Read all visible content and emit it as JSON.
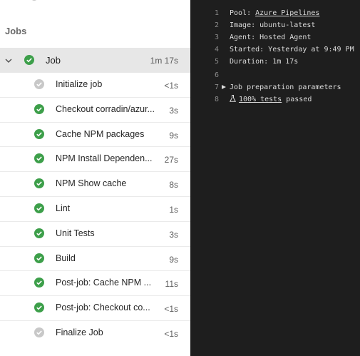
{
  "left": {
    "heading": "Jobs",
    "job": {
      "name": "Job",
      "duration": "1m 17s",
      "status": "success"
    },
    "steps": [
      {
        "name": "Initialize job",
        "duration": "<1s",
        "status": "skipped"
      },
      {
        "name": "Checkout corradin/azur...",
        "duration": "3s",
        "status": "success"
      },
      {
        "name": "Cache NPM packages",
        "duration": "9s",
        "status": "success"
      },
      {
        "name": "NPM Install Dependen...",
        "duration": "27s",
        "status": "success"
      },
      {
        "name": "NPM Show cache",
        "duration": "8s",
        "status": "success"
      },
      {
        "name": "Lint",
        "duration": "1s",
        "status": "success"
      },
      {
        "name": "Unit Tests",
        "duration": "3s",
        "status": "success"
      },
      {
        "name": "Build",
        "duration": "9s",
        "status": "success"
      },
      {
        "name": "Post-job: Cache NPM ...",
        "duration": "11s",
        "status": "success"
      },
      {
        "name": "Post-job: Checkout co...",
        "duration": "<1s",
        "status": "success"
      },
      {
        "name": "Finalize Job",
        "duration": "<1s",
        "status": "skipped"
      }
    ]
  },
  "log": {
    "line1": {
      "num": "1",
      "label": "Pool: ",
      "link": "Azure Pipelines"
    },
    "line2": {
      "num": "2",
      "text": "Image: ubuntu-latest"
    },
    "line3": {
      "num": "3",
      "text": "Agent: Hosted Agent"
    },
    "line4": {
      "num": "4",
      "text": "Started: Yesterday at 9:49 PM"
    },
    "line5": {
      "num": "5",
      "text": "Duration: 1m 17s"
    },
    "line6": {
      "num": "6",
      "text": ""
    },
    "line7": {
      "num": "7",
      "text": "Job preparation parameters"
    },
    "line8": {
      "num": "8",
      "link": "100% tests",
      "suffix": " passed"
    }
  },
  "colors": {
    "success": "#3d9f4a",
    "skipped": "#c8c8c8",
    "selected_row": "#e7e7e7",
    "log_bg": "#1e1e1e"
  },
  "icons": {
    "success": "check-circle-icon",
    "skipped": "check-circle-gray-icon",
    "chevron": "chevron-down-icon",
    "expand": "triangle-right-icon",
    "flask": "flask-icon"
  }
}
